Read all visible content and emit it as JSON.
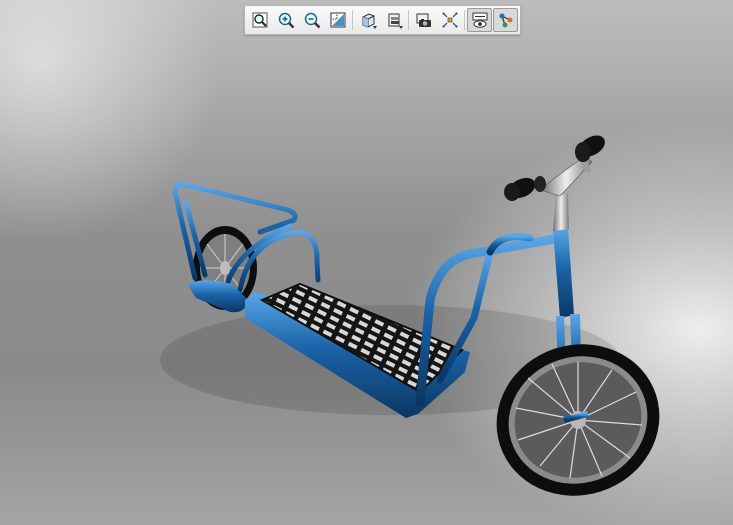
{
  "viewer": {
    "background_top": "#bdbdbd",
    "background_mid": "#8f8f8f",
    "model_color": "#1a63a8",
    "deck_color": "#1b1b1b",
    "tire_color": "#0d0d0d",
    "grip_color": "#111111"
  },
  "toolbar": {
    "buttons": [
      {
        "name": "zoom-fit",
        "icon": "magnifier-page-icon",
        "active": false
      },
      {
        "name": "zoom-in",
        "icon": "zoom-in-icon",
        "active": false
      },
      {
        "name": "zoom-out",
        "icon": "zoom-out-icon",
        "active": false
      },
      {
        "name": "zoom-to-area",
        "icon": "zoom-area-icon",
        "active": false
      },
      {
        "name": "view-orientation",
        "icon": "cube-icon",
        "active": false,
        "dropdown": true
      },
      {
        "name": "display-style",
        "icon": "display-style-icon",
        "active": false,
        "dropdown": true
      },
      {
        "name": "snapshot",
        "icon": "camera-icon",
        "active": false
      },
      {
        "name": "explode",
        "icon": "explode-icon",
        "active": false
      },
      {
        "name": "show-hide",
        "icon": "eye-tree-icon",
        "active": true
      },
      {
        "name": "assembly-tree",
        "icon": "tree-nodes-icon",
        "active": true
      }
    ]
  }
}
